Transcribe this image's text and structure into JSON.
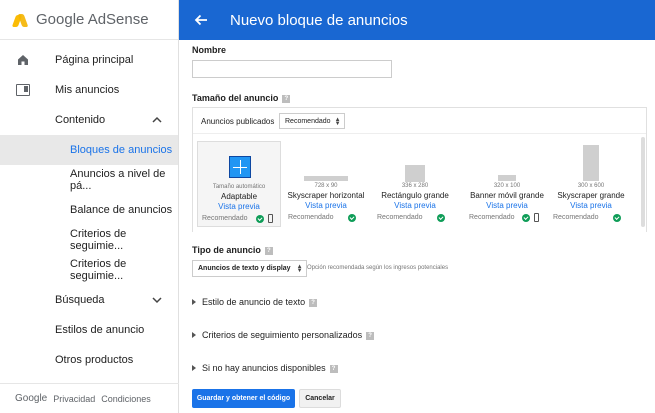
{
  "brand": {
    "name": "Google AdSense"
  },
  "sidebar": {
    "items": [
      {
        "label": "Página principal"
      },
      {
        "label": "Mis anuncios"
      },
      {
        "label": "Contenido"
      },
      {
        "label": "Bloques de anuncios"
      },
      {
        "label": "Anuncios a nivel de pá..."
      },
      {
        "label": "Balance de anuncios"
      },
      {
        "label": "Criterios de seguimie..."
      },
      {
        "label": "Criterios de seguimie..."
      },
      {
        "label": "Búsqueda"
      },
      {
        "label": "Estilos de anuncio"
      },
      {
        "label": "Otros productos"
      }
    ],
    "footer": {
      "google": "Google",
      "privacy": "Privacidad",
      "terms": "Condiciones"
    }
  },
  "header": {
    "title": "Nuevo bloque de anuncios"
  },
  "form": {
    "name_label": "Nombre",
    "name_value": "",
    "size_label": "Tamaño del anuncio",
    "published_label": "Anuncios publicados",
    "published_select": "Recomendado",
    "cards": [
      {
        "dims": "Tamaño automático",
        "name": "Adaptable",
        "preview": "Vista previa",
        "rec": "Recomendado"
      },
      {
        "dims": "728 x 90",
        "name": "Skyscraper horizontal",
        "preview": "Vista previa",
        "rec": "Recomendado"
      },
      {
        "dims": "336 x 280",
        "name": "Rectángulo grande",
        "preview": "Vista previa",
        "rec": "Recomendado"
      },
      {
        "dims": "320 x 100",
        "name": "Banner móvil grande",
        "preview": "Vista previa",
        "rec": "Recomendado"
      },
      {
        "dims": "300 x 600",
        "name": "Skyscraper grande",
        "preview": "Vista previa",
        "rec": "Recomendado"
      }
    ],
    "type_label": "Tipo de anuncio",
    "type_select": "Anuncios de texto y display",
    "type_hint": "Opción recomendada según los ingresos potenciales",
    "expanders": [
      {
        "label": "Estilo de anuncio de texto"
      },
      {
        "label": "Criterios de seguimiento personalizados"
      },
      {
        "label": "Si no hay anuncios disponibles"
      }
    ],
    "save_button": "Guardar y obtener el código",
    "cancel_button": "Cancelar"
  },
  "colors": {
    "header_blue": "#1967d2",
    "accent": "#1a73e8",
    "check_green": "#0f9d58"
  }
}
